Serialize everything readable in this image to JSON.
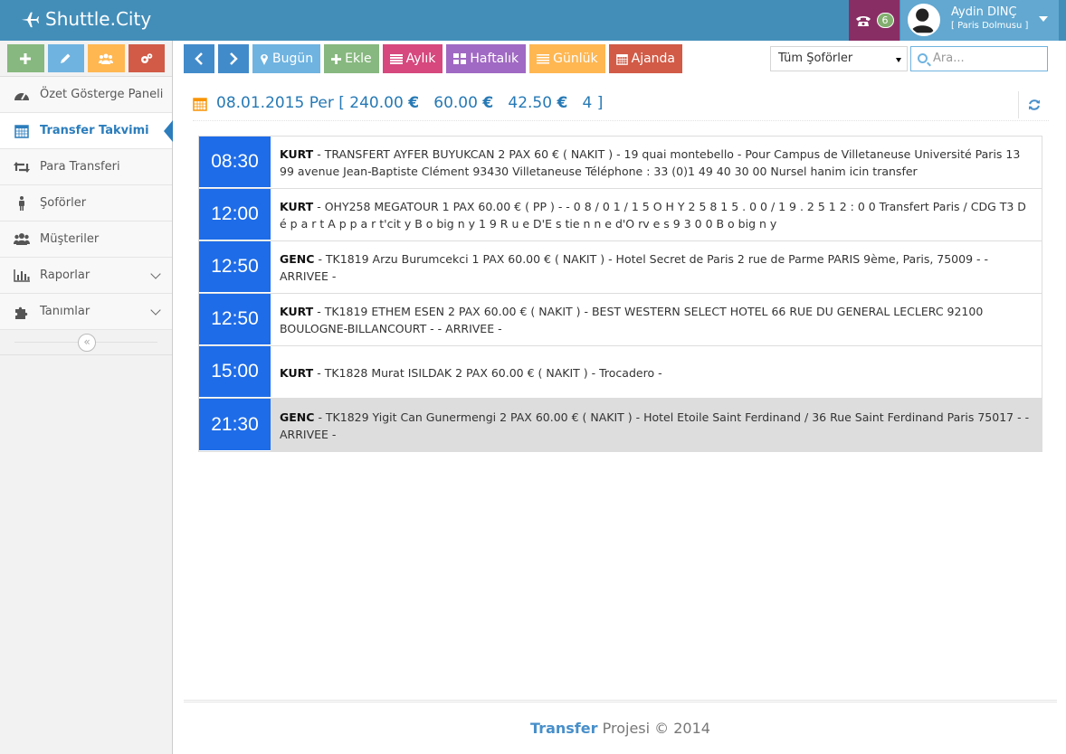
{
  "brand": {
    "name": "Shuttle.City"
  },
  "topbar": {
    "notif_count": "6",
    "user_name": "Aydin DINÇ",
    "user_role": "[ Paris Dolmusu ]"
  },
  "colors": {
    "navbar": "#438EB9",
    "time_block": "#1E6CE8",
    "active_nav": "#2B7DBC"
  },
  "sidebar": {
    "shortcuts": [
      {
        "icon": "plus-icon",
        "color": "#87B87F"
      },
      {
        "icon": "pencil-icon",
        "color": "#6FB3E0"
      },
      {
        "icon": "group-icon",
        "color": "#FFB752"
      },
      {
        "icon": "cogs-icon",
        "color": "#D15B47"
      }
    ],
    "items": [
      {
        "label": "Özet Gösterge Paneli",
        "icon": "dashboard-icon"
      },
      {
        "label": "Transfer Takvimi",
        "icon": "calendar-icon",
        "active": true
      },
      {
        "label": "Para Transferi",
        "icon": "retweet-icon"
      },
      {
        "label": "Şoförler",
        "icon": "male-icon"
      },
      {
        "label": "Müşteriler",
        "icon": "users-icon"
      },
      {
        "label": "Raporlar",
        "icon": "bar-chart-icon",
        "submenu": true
      },
      {
        "label": "Tanımlar",
        "icon": "puzzle-icon",
        "submenu": true
      }
    ]
  },
  "toolbar": {
    "prev": "‹",
    "next": "›",
    "today": "Bugün",
    "add": "Ekle",
    "monthly": "Aylık",
    "weekly": "Haftalık",
    "daily": "Günlük",
    "agenda": "Ajanda",
    "driver_select": "Tüm Şoförler",
    "search_placeholder": "Ara..."
  },
  "header": {
    "date": "08.01.2015 Per",
    "total1": "240.00",
    "total2": "60.00",
    "total3": "42.50",
    "count": "4",
    "currency": "€"
  },
  "agenda": [
    {
      "time": "08:30",
      "driver": "KURT",
      "text": "- TRANSFERT AYFER BUYUKCAN 2 PAX 60 € ( NAKIT ) - 19 quai montebello - Pour Campus de Villetaneuse Université Paris 13 99 avenue Jean-Baptiste Clément 93430 Villetaneuse Téléphone : 33 (0)1 49 40 30 00 Nursel hanim icin transfer"
    },
    {
      "time": "12:00",
      "driver": "KURT",
      "text": "- OHY258 MEGATOUR 1 PAX 60.00 € ( PP ) - - 0 8 / 0 1 / 1 5 O H Y 2 5 8 1 5 . 0 0 / 1 9 . 2 5 1 2 : 0 0 Transfert Paris / CDG T3 D é p a r t A p p a r t'cit y B o big n y 1 9 R u e D'E s tie n n e d'O rv e s 9 3 0 0 B o big n y"
    },
    {
      "time": "12:50",
      "driver": "GENC",
      "text": "- TK1819 Arzu Burumcekci 1 PAX 60.00 € ( NAKIT ) - Hotel Secret de Paris 2 rue de Parme PARIS 9ème, Paris, 75009 - - ARRIVEE -"
    },
    {
      "time": "12:50",
      "driver": "KURT",
      "text": "- TK1819 ETHEM ESEN 2 PAX 60.00 € ( NAKIT ) - BEST WESTERN SELECT HOTEL 66 RUE DU GENERAL LECLERC 92100 BOULOGNE-BILLANCOURT - - ARRIVEE -"
    },
    {
      "time": "15:00",
      "driver": "KURT",
      "text": "- TK1828 Murat ISILDAK 2 PAX 60.00 € ( NAKIT ) - Trocadero -"
    },
    {
      "time": "21:30",
      "driver": "GENC",
      "text": "- TK1829 Yigit Can Gunermengi 2 PAX 60.00 € ( NAKIT ) - Hotel Etoile Saint Ferdinand / 36 Rue Saint Ferdinand Paris 75017 - - ARRIVEE -",
      "highlight": true
    }
  ],
  "footer": {
    "brand": "Transfer",
    "text": "Projesi © 2014"
  }
}
